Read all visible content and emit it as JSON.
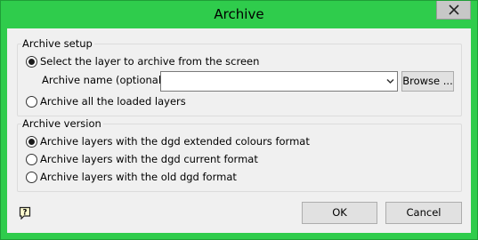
{
  "window": {
    "title": "Archive",
    "close_icon": "close-icon"
  },
  "archive_setup": {
    "group_label": "Archive setup",
    "option_select_layer": {
      "label": "Select the layer to archive from the screen",
      "checked": true
    },
    "archive_name_label": "Archive name (optional)",
    "archive_name_value": "",
    "browse_label": "Browse ...",
    "option_all_layers": {
      "label": "Archive all the loaded layers",
      "checked": false
    }
  },
  "archive_version": {
    "group_label": "Archive version",
    "options": [
      {
        "label": "Archive layers with the dgd extended colours format",
        "checked": true
      },
      {
        "label": "Archive layers with the dgd current format",
        "checked": false
      },
      {
        "label": "Archive layers with the old dgd format",
        "checked": false
      }
    ]
  },
  "footer": {
    "help_icon": "help-icon",
    "ok_label": "OK",
    "cancel_label": "Cancel"
  },
  "colors": {
    "titlebar": "#2fcc4c",
    "client": "#f0f0f0"
  }
}
